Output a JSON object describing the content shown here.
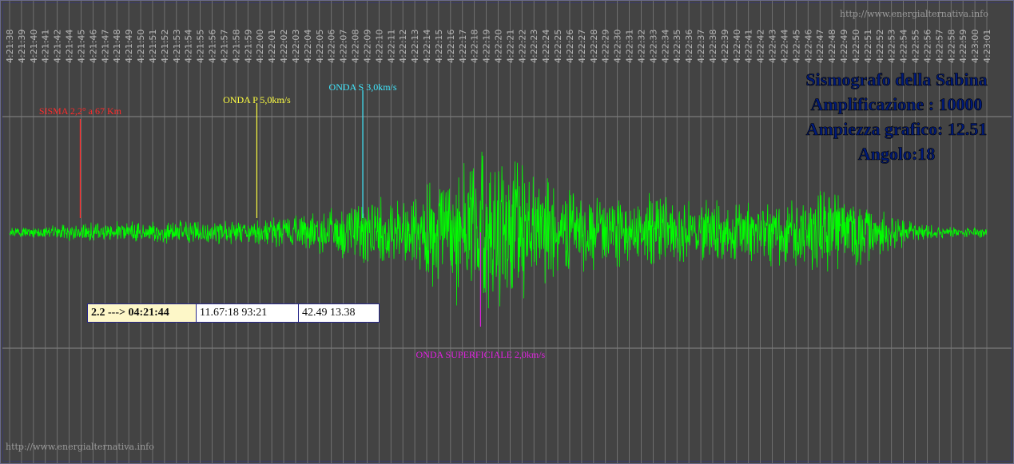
{
  "watermark_top": "http://www.energialternativa.info",
  "watermark_bottom": "http://www.energialternativa.info",
  "title_block": {
    "line1": "Sismografo della Sabina",
    "line2": "Amplificazione : 10000",
    "line3": "Ampiezza grafico: 12.51",
    "line4": "Angolo:18"
  },
  "info_box": {
    "main": "2.2 ---> 04:21:44",
    "cell_a": "11.67:18 93:21",
    "cell_b": "42.49 13.38"
  },
  "markers": [
    {
      "key": "sisma",
      "label": "SISMA 2,2° a 67 Km",
      "color": "#ff2a2a",
      "time": "4:21:44"
    },
    {
      "key": "onda_p",
      "label": "ONDA P 5,0km/s",
      "color": "#ffff40",
      "time": "4:21:59"
    },
    {
      "key": "onda_s",
      "label": "ONDA S 3,0km/s",
      "color": "#40e8ff",
      "time": "4:22:08"
    },
    {
      "key": "onda_sup",
      "label": "ONDA SUPERFICIALE 2,0km/s",
      "color": "#e020e0",
      "time": "4:22:18"
    }
  ],
  "chart_data": {
    "type": "line",
    "title": "",
    "xlabel": "",
    "ylabel": "",
    "series_color": "#00ff00",
    "grid": true,
    "tick_labels": [
      "4:21:38",
      "4:21:39",
      "4:21:40",
      "4:21:41",
      "4:21:42",
      "4:21:44",
      "4:21:45",
      "4:21:46",
      "4:21:47",
      "4:21:48",
      "4:21:49",
      "4:21:50",
      "4:21:51",
      "4:21:52",
      "4:21:53",
      "4:21:54",
      "4:21:55",
      "4:21:56",
      "4:21:57",
      "4:21:58",
      "4:21:59",
      "4:22:00",
      "4:22:01",
      "4:22:02",
      "4:22:03",
      "4:22:04",
      "4:22:05",
      "4:22:06",
      "4:22:07",
      "4:22:08",
      "4:22:09",
      "4:22:10",
      "4:22:11",
      "4:22:12",
      "4:22:13",
      "4:22:14",
      "4:22:15",
      "4:22:16",
      "4:22:17",
      "4:22:18",
      "4:22:19",
      "4:22:20",
      "4:22:21",
      "4:22:22",
      "4:22:23",
      "4:22:24",
      "4:22:25",
      "4:22:26",
      "4:22:27",
      "4:22:28",
      "4:22:29",
      "4:22:30",
      "4:22:31",
      "4:22:32",
      "4:22:33",
      "4:22:34",
      "4:22:35",
      "4:22:36",
      "4:22:37",
      "4:22:38",
      "4:22:39",
      "4:22:40",
      "4:22:41",
      "4:22:42",
      "4:22:43",
      "4:22:44",
      "4:22:45",
      "4:22:46",
      "4:22:47",
      "4:22:48",
      "4:22:49",
      "4:22:50",
      "4:22:51",
      "4:22:52",
      "4:22:53",
      "4:22:54",
      "4:22:55",
      "4:22:56",
      "4:22:57",
      "4:22:58",
      "4:22:59",
      "4:23:00",
      "4:23:01"
    ],
    "amplitude_envelope": [
      {
        "time": "4:21:38",
        "amp": 0.06
      },
      {
        "time": "4:21:44",
        "amp": 0.1
      },
      {
        "time": "4:21:50",
        "amp": 0.12
      },
      {
        "time": "4:21:59",
        "amp": 0.14
      },
      {
        "time": "4:22:04",
        "amp": 0.2
      },
      {
        "time": "4:22:08",
        "amp": 0.32
      },
      {
        "time": "4:22:12",
        "amp": 0.4
      },
      {
        "time": "4:22:18",
        "amp": 0.95
      },
      {
        "time": "4:22:21",
        "amp": 0.8
      },
      {
        "time": "4:22:25",
        "amp": 0.45
      },
      {
        "time": "4:22:30",
        "amp": 0.4
      },
      {
        "time": "4:22:36",
        "amp": 0.35
      },
      {
        "time": "4:22:40",
        "amp": 0.3
      },
      {
        "time": "4:22:47",
        "amp": 0.45
      },
      {
        "time": "4:22:50",
        "amp": 0.35
      },
      {
        "time": "4:22:53",
        "amp": 0.18
      },
      {
        "time": "4:22:57",
        "amp": 0.06
      },
      {
        "time": "4:23:01",
        "amp": 0.05
      }
    ]
  }
}
